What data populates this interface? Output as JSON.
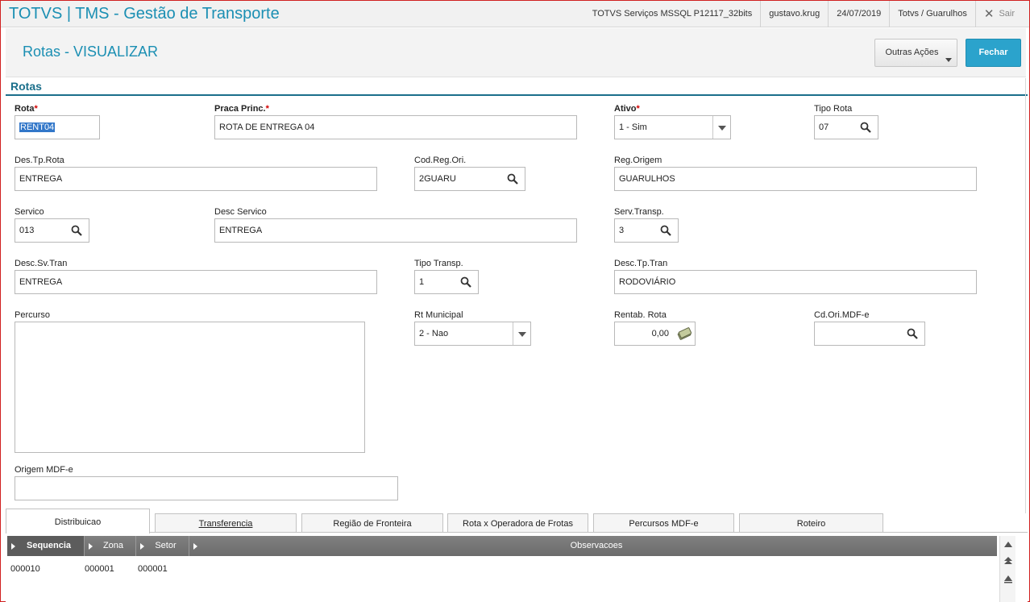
{
  "app": {
    "title": "TOTVS | TMS - Gestão de Transporte"
  },
  "topbar": {
    "environment": "TOTVS Serviços MSSQL P12117_32bits",
    "user": "gustavo.krug",
    "date": "24/07/2019",
    "branch": "Totvs / Guarulhos",
    "exit_label": "Sair"
  },
  "header": {
    "title": "Rotas - VISUALIZAR",
    "other_actions_label": "Outras Ações",
    "close_label": "Fechar"
  },
  "section": {
    "title": "Rotas"
  },
  "fields": {
    "rota": {
      "label": "Rota",
      "value": "RENT04"
    },
    "praca": {
      "label": "Praca Princ.",
      "value": "ROTA DE ENTREGA 04"
    },
    "ativo": {
      "label": "Ativo",
      "value": "1 - Sim"
    },
    "tipo_rota": {
      "label": "Tipo Rota",
      "value": "07"
    },
    "des_tp_rota": {
      "label": "Des.Tp.Rota",
      "value": "ENTREGA"
    },
    "cod_reg_ori": {
      "label": "Cod.Reg.Ori.",
      "value": "2GUARU"
    },
    "reg_origem": {
      "label": "Reg.Origem",
      "value": "GUARULHOS"
    },
    "servico": {
      "label": "Servico",
      "value": "013"
    },
    "desc_servico": {
      "label": "Desc Servico",
      "value": "ENTREGA"
    },
    "serv_transp": {
      "label": "Serv.Transp.",
      "value": "3"
    },
    "desc_sv_tran": {
      "label": "Desc.Sv.Tran",
      "value": "ENTREGA"
    },
    "tipo_transp": {
      "label": "Tipo Transp.",
      "value": "1"
    },
    "desc_tp_tran": {
      "label": "Desc.Tp.Tran",
      "value": "RODOVIÁRIO"
    },
    "percurso": {
      "label": "Percurso",
      "value": ""
    },
    "rt_municipal": {
      "label": "Rt Municipal",
      "value": "2 - Nao"
    },
    "rentab_rota": {
      "label": "Rentab. Rota",
      "value": "0,00"
    },
    "cd_ori_mdfe": {
      "label": "Cd.Ori.MDF-e",
      "value": ""
    },
    "origem_mdfe": {
      "label": "Origem MDF-e",
      "value": ""
    }
  },
  "tabs": [
    {
      "label": "Distribuicao"
    },
    {
      "label": "Transferencia"
    },
    {
      "label": "Região de Fronteira"
    },
    {
      "label": "Rota x Operadora de Frotas"
    },
    {
      "label": "Percursos MDF-e"
    },
    {
      "label": "Roteiro"
    }
  ],
  "grid": {
    "columns": [
      "Sequencia",
      "Zona",
      "Setor",
      "Observacoes"
    ],
    "rows": [
      {
        "sequencia": "000010",
        "zona": "000001",
        "setor": "000001",
        "observacoes": ""
      }
    ]
  },
  "colors": {
    "accent": "#1b8fb3",
    "primary_button": "#2ba3cc",
    "section": "#1b6f8b",
    "required": "#d20000"
  }
}
